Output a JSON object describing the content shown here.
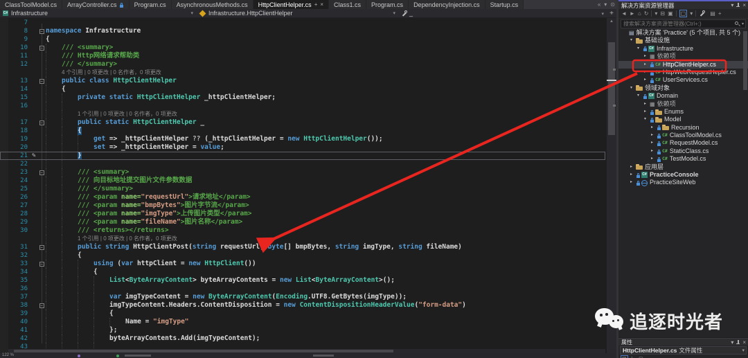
{
  "colors": {
    "accent_red": "#e8251f",
    "keyword": "#569cd6",
    "type": "#4ec9b0",
    "string": "#d69d85",
    "comment": "#57a64a",
    "line_number": "#2b91af",
    "panel_focus": "#5b5fc7"
  },
  "tabs": [
    {
      "label": "ClassToolModel.cs"
    },
    {
      "label": "ArrayController.cs",
      "lock": true
    },
    {
      "label": "Program.cs"
    },
    {
      "label": "AsynchronousMethods.cs"
    },
    {
      "label": "HttpClientHelper.cs",
      "active": true,
      "pin": true,
      "close": true
    },
    {
      "label": "Class1.cs"
    },
    {
      "label": "Program.cs"
    },
    {
      "label": "DependencyInjection.cs"
    },
    {
      "label": "Startup.cs"
    }
  ],
  "tabbar_icons": [
    {
      "name": "scroll-tabs-icon",
      "glyph": "«"
    },
    {
      "name": "tab-list-icon",
      "glyph": "▾"
    },
    {
      "name": "tab-options-icon",
      "glyph": "⊙"
    }
  ],
  "navbar": {
    "project": "Infrastructure",
    "type": "Infrastructure.HttpClientHelper",
    "member": "_",
    "split_button": "+"
  },
  "editor": {
    "rows": [
      {
        "n": "7"
      },
      {
        "n": "8",
        "fold": true,
        "tokens": [
          [
            "kw",
            "namespace"
          ],
          [
            "pl",
            " Infrastructure"
          ]
        ]
      },
      {
        "n": "9",
        "tokens": [
          [
            "pl",
            "{"
          ]
        ]
      },
      {
        "n": "10",
        "ind": 1,
        "fold": true,
        "tokens": [
          [
            "doc",
            "/// <summary>"
          ]
        ]
      },
      {
        "n": "11",
        "ind": 1,
        "tokens": [
          [
            "doc",
            "/// Http网络请求帮助类"
          ]
        ]
      },
      {
        "n": "12",
        "ind": 1,
        "tokens": [
          [
            "doc",
            "/// </summary>"
          ]
        ]
      },
      {
        "n": "",
        "ind": 1,
        "tokens": [
          [
            "cl",
            "4 个引用 | 0 项更改 | 0 名作者，0 项更改"
          ]
        ]
      },
      {
        "n": "13",
        "ind": 1,
        "fold": true,
        "tokens": [
          [
            "kw",
            "public class "
          ],
          [
            "type",
            "HttpClientHelper"
          ]
        ]
      },
      {
        "n": "14",
        "ind": 1,
        "tokens": [
          [
            "pl",
            "{"
          ]
        ]
      },
      {
        "n": "15",
        "ind": 2,
        "tokens": [
          [
            "kw",
            "private static "
          ],
          [
            "type",
            "HttpClientHelper"
          ],
          [
            "pl",
            " _httpClientHelper;"
          ]
        ]
      },
      {
        "n": "16",
        "ind": 2
      },
      {
        "n": "",
        "ind": 2,
        "tokens": [
          [
            "cl",
            "1 个引用 | 0 项更改 | 0 名作者，0 项更改"
          ]
        ]
      },
      {
        "n": "17",
        "ind": 2,
        "fold": true,
        "tokens": [
          [
            "kw",
            "public static "
          ],
          [
            "type",
            "HttpClientHelper"
          ],
          [
            "pl",
            " _"
          ]
        ]
      },
      {
        "n": "18",
        "ind": 2,
        "tokens": [
          [
            "sel",
            "{"
          ]
        ]
      },
      {
        "n": "19",
        "ind": 3,
        "tokens": [
          [
            "kw",
            "get"
          ],
          [
            "pl",
            " => _httpClientHelper "
          ],
          [
            "op",
            "??"
          ],
          [
            "pl",
            " (_httpClientHelper = "
          ],
          [
            "kw",
            "new"
          ],
          [
            "pl",
            " "
          ],
          [
            "type",
            "HttpClientHelper"
          ],
          [
            "pl",
            "());"
          ]
        ]
      },
      {
        "n": "20",
        "ind": 3,
        "tokens": [
          [
            "kw",
            "set"
          ],
          [
            "pl",
            " => _httpClientHelper = "
          ],
          [
            "kw",
            "value"
          ],
          [
            "pl",
            ";"
          ]
        ]
      },
      {
        "n": "21",
        "ind": 2,
        "cur": true,
        "pencil": true,
        "tokens": [
          [
            "sel",
            "}"
          ]
        ]
      },
      {
        "n": "22",
        "ind": 2
      },
      {
        "n": "23",
        "ind": 2,
        "fold": true,
        "tokens": [
          [
            "doc",
            "/// <summary>"
          ]
        ]
      },
      {
        "n": "24",
        "ind": 2,
        "tokens": [
          [
            "doc",
            "/// 向目标地址提交图片文件参数数据"
          ]
        ]
      },
      {
        "n": "25",
        "ind": 2,
        "tokens": [
          [
            "doc",
            "/// </summary>"
          ]
        ]
      },
      {
        "n": "26",
        "ind": 2,
        "tokens": [
          [
            "doc",
            "/// <param "
          ],
          [
            "attr",
            "name="
          ],
          [
            "str",
            "\"requestUrl\""
          ],
          [
            "doc",
            ">请求地址</param>"
          ]
        ]
      },
      {
        "n": "27",
        "ind": 2,
        "tokens": [
          [
            "doc",
            "/// <param "
          ],
          [
            "attr",
            "name="
          ],
          [
            "str",
            "\"bmpBytes\""
          ],
          [
            "doc",
            ">图片字节流</param>"
          ]
        ]
      },
      {
        "n": "28",
        "ind": 2,
        "tokens": [
          [
            "doc",
            "/// <param "
          ],
          [
            "attr",
            "name="
          ],
          [
            "str",
            "\"imgType\""
          ],
          [
            "doc",
            ">上传图片类型</param>"
          ]
        ]
      },
      {
        "n": "29",
        "ind": 2,
        "tokens": [
          [
            "doc",
            "/// <param "
          ],
          [
            "attr",
            "name="
          ],
          [
            "str",
            "\"fileName\""
          ],
          [
            "doc",
            ">图片名称</param>"
          ]
        ]
      },
      {
        "n": "30",
        "ind": 2,
        "tokens": [
          [
            "doc",
            "/// <returns></returns>"
          ]
        ]
      },
      {
        "n": "",
        "ind": 2,
        "tokens": [
          [
            "cl",
            "1 个引用 | 0 项更改 | 0 名作者，0 项更改"
          ]
        ]
      },
      {
        "n": "31",
        "ind": 2,
        "fold": true,
        "tokens": [
          [
            "kw",
            "public string"
          ],
          [
            "m",
            " HttpClientPost("
          ],
          [
            "kw",
            "string"
          ],
          [
            "pl",
            " requestUrl, "
          ],
          [
            "kw",
            "byte"
          ],
          [
            "pl",
            "[] bmpBytes, "
          ],
          [
            "kw",
            "string"
          ],
          [
            "pl",
            " imgType, "
          ],
          [
            "kw",
            "string"
          ],
          [
            "pl",
            " fileName)"
          ]
        ]
      },
      {
        "n": "32",
        "ind": 2,
        "tokens": [
          [
            "pl",
            "{"
          ]
        ]
      },
      {
        "n": "33",
        "ind": 3,
        "fold": true,
        "tokens": [
          [
            "kw",
            "using"
          ],
          [
            "pl",
            " ("
          ],
          [
            "kw",
            "var"
          ],
          [
            "pl",
            " httpClient = "
          ],
          [
            "kw",
            "new"
          ],
          [
            "pl",
            " "
          ],
          [
            "type",
            "HttpClient"
          ],
          [
            "pl",
            "())"
          ]
        ]
      },
      {
        "n": "34",
        "ind": 3,
        "tokens": [
          [
            "pl",
            "{"
          ]
        ]
      },
      {
        "n": "35",
        "ind": 4,
        "tokens": [
          [
            "type",
            "List"
          ],
          [
            "pl",
            "<"
          ],
          [
            "type",
            "ByteArrayContent"
          ],
          [
            "pl",
            "> byteArrayContents = "
          ],
          [
            "kw",
            "new"
          ],
          [
            "pl",
            " "
          ],
          [
            "type",
            "List"
          ],
          [
            "pl",
            "<"
          ],
          [
            "type",
            "ByteArrayContent"
          ],
          [
            "pl",
            ">();"
          ]
        ]
      },
      {
        "n": "36",
        "ind": 4
      },
      {
        "n": "37",
        "ind": 4,
        "tokens": [
          [
            "kw",
            "var"
          ],
          [
            "pl",
            " imgTypeContent = "
          ],
          [
            "kw",
            "new"
          ],
          [
            "pl",
            " "
          ],
          [
            "type",
            "ByteArrayContent"
          ],
          [
            "pl",
            "("
          ],
          [
            "type",
            "Encoding"
          ],
          [
            "pl",
            ".UTF8.GetBytes(imgType));"
          ]
        ]
      },
      {
        "n": "38",
        "ind": 4,
        "fold": true,
        "tokens": [
          [
            "pl",
            "imgTypeContent.Headers.ContentDisposition = "
          ],
          [
            "kw",
            "new"
          ],
          [
            "pl",
            " "
          ],
          [
            "type",
            "ContentDispositionHeaderValue"
          ],
          [
            "pl",
            "("
          ],
          [
            "str",
            "\"form-data\""
          ],
          [
            "pl",
            ")"
          ]
        ]
      },
      {
        "n": "39",
        "ind": 4,
        "tokens": [
          [
            "pl",
            "{"
          ]
        ]
      },
      {
        "n": "40",
        "ind": 5,
        "tokens": [
          [
            "pl",
            "Name = "
          ],
          [
            "str",
            "\"imgType\""
          ]
        ]
      },
      {
        "n": "41",
        "ind": 4,
        "tokens": [
          [
            "pl",
            "};"
          ]
        ]
      },
      {
        "n": "42",
        "ind": 4,
        "tokens": [
          [
            "pl",
            "byteArrayContents.Add(imgTypeContent);"
          ]
        ]
      },
      {
        "n": "43",
        "ind": 4
      }
    ]
  },
  "status": {
    "zoom": "122 %"
  },
  "solution_explorer": {
    "title": "解决方案资源管理器",
    "search_placeholder": "搜索解决方案资源管理器(Ctrl+;)",
    "toolbar_icons": [
      {
        "name": "back-icon",
        "glyph": "◄"
      },
      {
        "name": "forward-icon",
        "glyph": "►"
      },
      {
        "name": "home-icon",
        "glyph": "⌂"
      },
      {
        "name": "switch-views-icon",
        "glyph": "↻"
      },
      {
        "sep": true
      },
      {
        "name": "pending-changes-filter-icon",
        "glyph": "▾"
      },
      {
        "name": "collapse-all-icon",
        "glyph": "⊟"
      },
      {
        "name": "properties-icon",
        "glyph": "▣"
      },
      {
        "sep": true
      },
      {
        "name": "sync-with-active-document-icon",
        "glyph": "▢",
        "boxed": true
      },
      {
        "name": "sync-dropdown-icon",
        "glyph": "▾"
      },
      {
        "sep": true
      },
      {
        "name": "wrench-icon",
        "glyph": "wrench"
      },
      {
        "name": "preview-icon",
        "glyph": "▤"
      },
      {
        "name": "add-item-icon",
        "glyph": "+"
      }
    ],
    "tree": [
      {
        "depth": 0,
        "icon": "solution",
        "label": "解决方案 'Practice' (5 个项目, 共 5 个)"
      },
      {
        "depth": 1,
        "exp": "▾",
        "icon": "folder",
        "label": "基础设施"
      },
      {
        "depth": 2,
        "exp": "▾",
        "lock": true,
        "icon": "csproj",
        "label": "Infrastructure"
      },
      {
        "depth": 3,
        "exp": "▸",
        "icon": "deps",
        "label": "依赖项",
        "dim": true
      },
      {
        "depth": 3,
        "exp": "▸",
        "lock": true,
        "icon": "csfile",
        "label": "HttpClientHelper.cs",
        "selected": true,
        "redbox": true
      },
      {
        "depth": 3,
        "exp": "▸",
        "lock": true,
        "icon": "csfile",
        "label": "HttpWebRequestHepler.cs"
      },
      {
        "depth": 3,
        "exp": "▸",
        "lock": true,
        "icon": "csfile",
        "label": "UserServices.cs"
      },
      {
        "depth": 1,
        "exp": "▾",
        "icon": "folder",
        "label": "领域对象"
      },
      {
        "depth": 2,
        "exp": "▾",
        "lock": true,
        "icon": "csproj",
        "label": "Domain"
      },
      {
        "depth": 3,
        "exp": "▸",
        "icon": "deps",
        "label": "依赖项",
        "dim": true
      },
      {
        "depth": 3,
        "exp": "▸",
        "lock": true,
        "icon": "folder",
        "label": "Enums"
      },
      {
        "depth": 3,
        "exp": "▾",
        "lock": true,
        "icon": "folder",
        "label": "Model"
      },
      {
        "depth": 4,
        "exp": "▸",
        "lock": true,
        "icon": "folder",
        "label": "Recursion"
      },
      {
        "depth": 4,
        "exp": "▸",
        "lock": true,
        "icon": "csfile",
        "label": "ClassToolModel.cs"
      },
      {
        "depth": 4,
        "exp": "▸",
        "lock": true,
        "icon": "csfile",
        "label": "RequestModel.cs"
      },
      {
        "depth": 4,
        "exp": "▸",
        "lock": true,
        "icon": "csfile",
        "label": "StaticClass.cs"
      },
      {
        "depth": 4,
        "exp": "▸",
        "lock": true,
        "icon": "csfile",
        "label": "TestModel.cs"
      },
      {
        "depth": 1,
        "exp": "▸",
        "icon": "folder",
        "label": "应用层"
      },
      {
        "depth": 1,
        "exp": "▸",
        "lock": true,
        "icon": "csproj",
        "label": "PracticeConsole",
        "bold": true
      },
      {
        "depth": 1,
        "exp": "▸",
        "lock": true,
        "icon": "web",
        "label": "PracticeSiteWeb"
      }
    ]
  },
  "watermark": {
    "text": "追逐时光者"
  },
  "properties_panel": {
    "title": "属性",
    "file_name": "HttpClientHelper.cs",
    "file_type_label": "文件属性",
    "toolbar_icons": [
      {
        "name": "categorized-icon",
        "glyph": "▤",
        "boxed": true
      },
      {
        "name": "alphabetical-sort-icon",
        "glyph": "↕"
      },
      {
        "sep": true
      },
      {
        "name": "property-pages-icon",
        "glyph": "▢"
      }
    ]
  }
}
